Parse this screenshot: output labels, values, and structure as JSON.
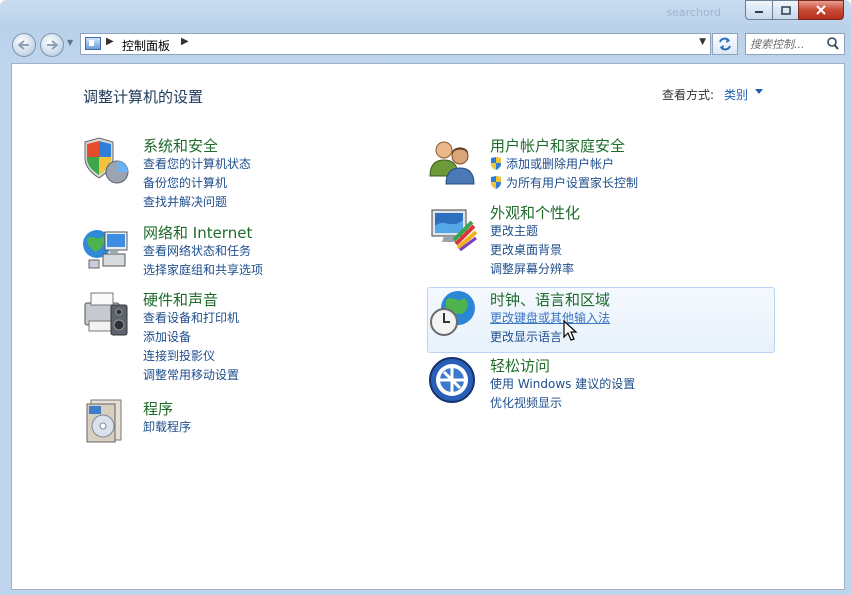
{
  "window": {
    "title_ghost": "searchord",
    "controls": {
      "minimize": "minimize-icon",
      "maximize": "maximize-icon",
      "close": "close-icon"
    }
  },
  "address_bar": {
    "breadcrumb": "控制面板",
    "search_placeholder": "搜索控制..."
  },
  "main": {
    "heading": "调整计算机的设置",
    "view_by_label": "查看方式:",
    "view_by_value": "类别",
    "categories": [
      {
        "title": "系统和安全",
        "icon": "shield-computer-icon",
        "links": [
          "查看您的计算机状态",
          "备份您的计算机",
          "查找并解决问题"
        ]
      },
      {
        "title": "网络和 Internet",
        "icon": "network-globe-icon",
        "links": [
          "查看网络状态和任务",
          "选择家庭组和共享选项"
        ]
      },
      {
        "title": "硬件和声音",
        "icon": "printer-speaker-icon",
        "links": [
          "查看设备和打印机",
          "添加设备",
          "连接到投影仪",
          "调整常用移动设置"
        ]
      },
      {
        "title": "程序",
        "icon": "programs-disc-icon",
        "links": [
          "卸载程序"
        ]
      },
      {
        "title": "用户帐户和家庭安全",
        "icon": "users-icon",
        "links": [
          "添加或删除用户帐户",
          "为所有用户设置家长控制"
        ]
      },
      {
        "title": "外观和个性化",
        "icon": "monitor-palette-icon",
        "links": [
          "更改主题",
          "更改桌面背景",
          "调整屏幕分辨率"
        ]
      },
      {
        "title": "时钟、语言和区域",
        "icon": "globe-clock-icon",
        "links": [
          "更改键盘或其他输入法",
          "更改显示语言"
        ]
      },
      {
        "title": "轻松访问",
        "icon": "ease-of-access-icon",
        "links": [
          "使用 Windows 建议的设置",
          "优化视频显示"
        ]
      }
    ]
  }
}
